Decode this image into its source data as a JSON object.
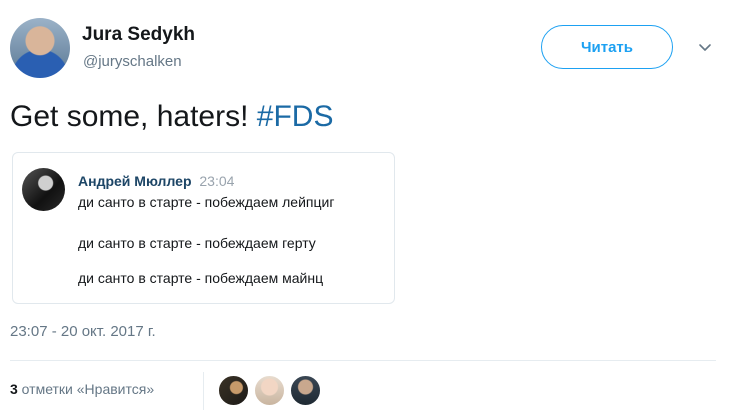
{
  "author": {
    "name": "Jura Sedykh",
    "handle": "@juryschalken"
  },
  "follow_button": {
    "label": "Читать"
  },
  "tweet": {
    "text": "Get some, haters! ",
    "hashtag": "#FDS"
  },
  "quoted_tweet": {
    "author_name": "Андрей Мюллер",
    "time": "23:04",
    "lines": [
      "ди санто в старте - побеждаем лейпциг",
      "ди санто в старте - побеждаем герту",
      "ди санто в старте - побеждаем майнц"
    ]
  },
  "timestamp": "23:07 - 20 окт. 2017 г.",
  "likes": {
    "count": "3",
    "label": " отметки «Нравится»"
  },
  "colors": {
    "accent": "#1da1f2",
    "hashtag": "#1b6aa5",
    "muted": "#657786"
  }
}
